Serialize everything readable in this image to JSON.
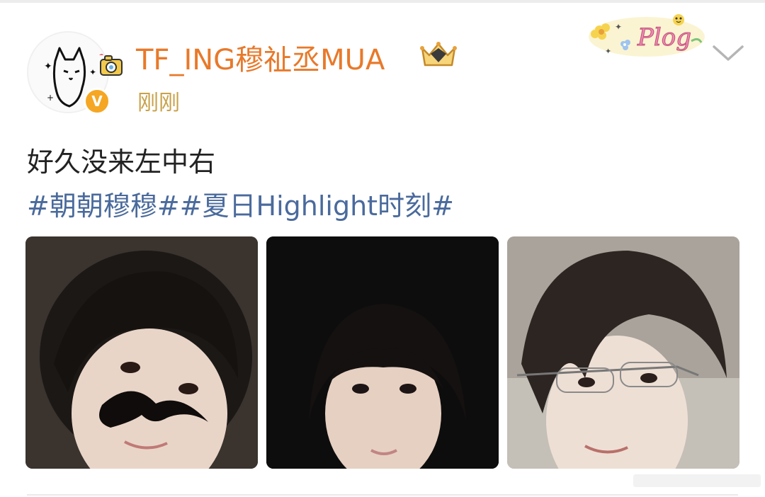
{
  "post": {
    "username": "TF_ING穆祉丞MUA",
    "timestamp": "刚刚",
    "text": "好久没来左中右",
    "hashtags": [
      "#朝朝穆穆#",
      "#夏日Highlight时刻#"
    ],
    "images": [
      {
        "alt": "photo-1"
      },
      {
        "alt": "photo-2"
      },
      {
        "alt": "photo-3"
      }
    ]
  },
  "decor": {
    "plog_sticker": "Plog",
    "verified_badge": "V"
  },
  "colors": {
    "username": "#e8792a",
    "timestamp": "#c8a24a",
    "hashtag": "#4a6a9c",
    "verified": "#f5a623"
  },
  "icons": {
    "verified": "verified-badge-icon",
    "crown": "crown-badge-icon",
    "more": "chevron-down-icon",
    "camera": "camera-sticker-icon"
  }
}
